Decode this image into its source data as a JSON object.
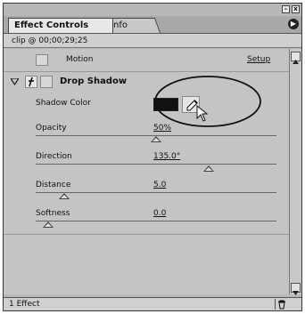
{
  "window": {
    "minimize_glyph": "–",
    "close_glyph": "x",
    "menu_icon": "panel-menu-arrow-icon"
  },
  "tabs": [
    {
      "label": "Effect Controls",
      "active": true
    },
    {
      "label": "Info",
      "active": false
    }
  ],
  "clip": {
    "label": "clip @ 00;00;29;25"
  },
  "motion": {
    "label": "Motion",
    "setup_link": "Setup"
  },
  "effect": {
    "name": "Drop Shadow",
    "enabled_icon": "fx-toggle-icon",
    "expand_icon": "disclosure-triangle-icon",
    "params": {
      "shadow_color": {
        "label": "Shadow Color",
        "color": "#111111",
        "eyedropper_icon": "eyedropper-icon"
      },
      "opacity": {
        "label": "Opacity",
        "value": "50%",
        "slider_fraction": 0.5
      },
      "direction": {
        "label": "Direction",
        "value": "135.0°",
        "slider_fraction": 0.72
      },
      "distance": {
        "label": "Distance",
        "value": "5.0",
        "slider_fraction": 0.12
      },
      "softness": {
        "label": "Softness",
        "value": "0.0",
        "slider_fraction": 0.05
      }
    }
  },
  "footer": {
    "status": "1 Effect",
    "trash_icon": "trash-icon"
  }
}
